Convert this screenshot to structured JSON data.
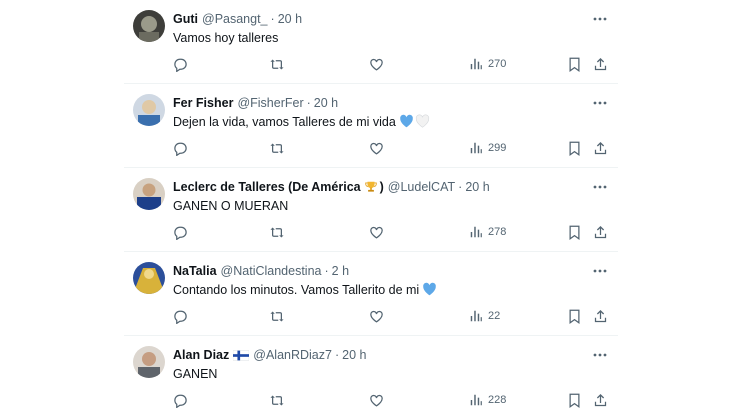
{
  "tweets": [
    {
      "name": "Guti",
      "handle": "@Pasangt_",
      "time": "20 h",
      "text": "Vamos hoy talleres",
      "views": "270",
      "emojis_after_text": [],
      "avatar_colors": [
        "#4a4a4a",
        "#9a9a8a"
      ]
    },
    {
      "name": "Fer Fisher",
      "handle": "@FisherFer",
      "time": "20 h",
      "text": "Dejen la vida, vamos Talleres de mi vida",
      "views": "299",
      "emojis_after_text": [
        "blue-heart",
        "white-heart"
      ],
      "avatar_colors": [
        "#6f9fc8",
        "#e0c9a6"
      ]
    },
    {
      "name": "Leclerc de Talleres (De América",
      "name_suffix": ")",
      "name_emoji": "trophy",
      "handle": "@LudelCAT",
      "time": "20 h",
      "text": "GANEN O MUERAN",
      "views": "278",
      "emojis_after_text": [],
      "avatar_colors": [
        "#1d3f8a",
        "#d9d0c4"
      ]
    },
    {
      "name": "NaTalia",
      "handle": "@NatiClandestina",
      "time": "2 h",
      "text": "Contando los minutos. Vamos Tallerito de mi",
      "views": "22",
      "emojis_after_text": [
        "blue-heart"
      ],
      "avatar_colors": [
        "#d8b23a",
        "#2c4f9a"
      ]
    },
    {
      "name": "Alan Diaz",
      "name_emoji": "finland-flag",
      "handle": "@AlanRDiaz7",
      "time": "20 h",
      "text": "GANEN",
      "views": "228",
      "emojis_after_text": [],
      "avatar_colors": [
        "#8a8f95",
        "#dcd6cf"
      ]
    }
  ],
  "colors": {
    "text": "#0f1419",
    "secondary": "#536471",
    "divider": "#eff3f4",
    "blue_heart": "#5da8e8"
  }
}
